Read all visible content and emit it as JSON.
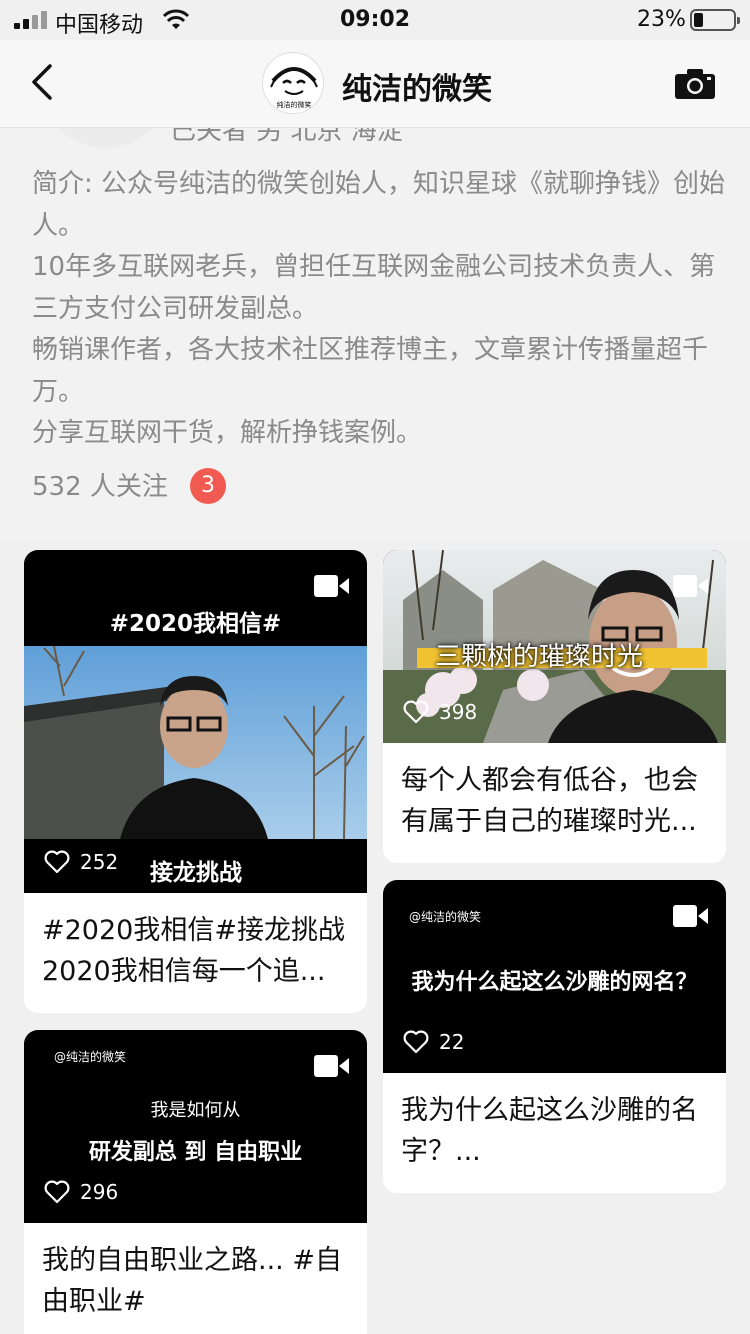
{
  "status_bar": {
    "carrier": "中国移动",
    "time": "09:02",
    "battery_percent": "23%",
    "battery_level": 0.23
  },
  "navbar": {
    "title": "纯洁的微笑",
    "avatar_text": "纯洁的微笑"
  },
  "profile": {
    "cutoff_line": "已关者 另 北京 海淀",
    "bio_lines": [
      "简介: 公众号纯洁的微笑创始人，知识星球《就聊挣钱》创始人。",
      "10年多互联网老兵，曾担任互联网金融公司技术负责人、第三方支付公司研发副总。",
      "畅销课作者，各大技术社区推荐博主，文章累计传播量超千万。",
      "分享互联网干货，解析挣钱案例。"
    ],
    "followers": "532 人关注",
    "badge_count": "3"
  },
  "cards": [
    {
      "thumb_title": "#2020我相信#",
      "thumb_subtitle": "接龙挑战",
      "likes": "252",
      "caption": "#2020我相信#接龙挑战2020我相信每一个追..."
    },
    {
      "thumb_title": "三颗树的璀璨时光",
      "likes": "398",
      "caption": "每个人都会有低谷，也会有属于自己的璀璨时光..."
    },
    {
      "thumb_watermark": "@纯洁的微笑",
      "thumb_title": "我为什么起这么沙雕的网名？",
      "likes": "22",
      "caption": "我为什么起这么沙雕的名字？..."
    },
    {
      "thumb_watermark": "@纯洁的微笑",
      "thumb_line1": "我是如何从",
      "thumb_line2": "研发副总 到 自由职业",
      "likes": "296",
      "caption": "我的自由职业之路... #自由职业#"
    }
  ],
  "colors": {
    "badge": "#f15a50",
    "background": "#f0f0f0",
    "card": "#ffffff",
    "secondary_text": "#8a8a8a"
  }
}
